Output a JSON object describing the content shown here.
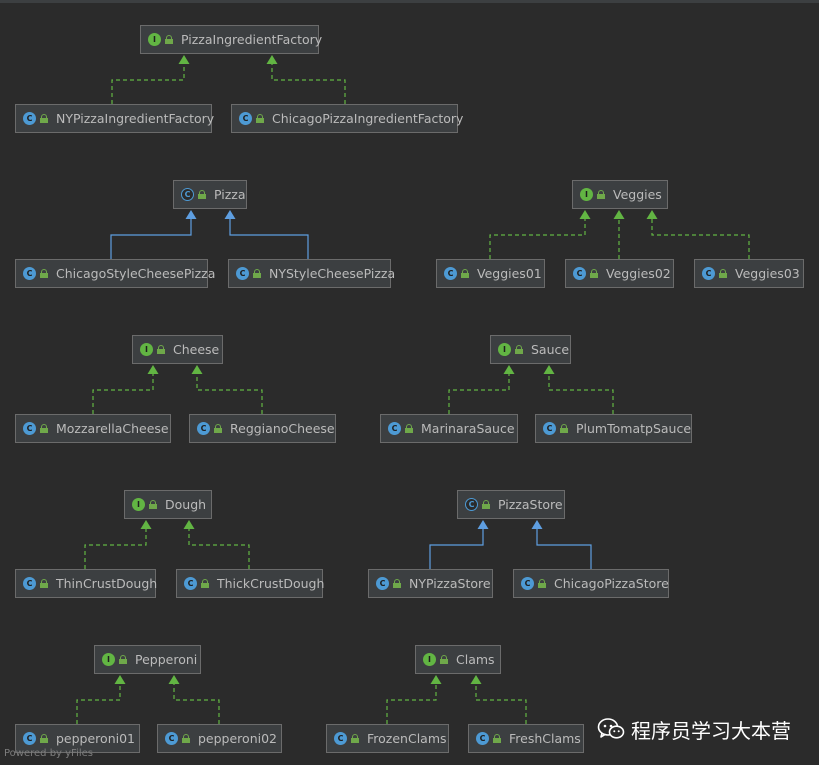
{
  "diagram": {
    "edge_colors": {
      "implements": "#62b543",
      "extends": "#5e9ee0"
    },
    "nodes": [
      {
        "id": "PizzaIngredientFactory",
        "label": "PizzaIngredientFactory",
        "kind": "interface"
      },
      {
        "id": "NYPizzaIngredientFactory",
        "label": "NYPizzaIngredientFactory",
        "kind": "class"
      },
      {
        "id": "ChicagoPizzaIngredientFactory",
        "label": "ChicagoPizzaIngredientFactory",
        "kind": "class"
      },
      {
        "id": "Pizza",
        "label": "Pizza",
        "kind": "abstract"
      },
      {
        "id": "ChicagoStyleCheesePizza",
        "label": "ChicagoStyleCheesePizza",
        "kind": "class"
      },
      {
        "id": "NYStyleCheesePizza",
        "label": "NYStyleCheesePizza",
        "kind": "class"
      },
      {
        "id": "Veggies",
        "label": "Veggies",
        "kind": "interface"
      },
      {
        "id": "Veggies01",
        "label": "Veggies01",
        "kind": "class"
      },
      {
        "id": "Veggies02",
        "label": "Veggies02",
        "kind": "class"
      },
      {
        "id": "Veggies03",
        "label": "Veggies03",
        "kind": "class"
      },
      {
        "id": "Cheese",
        "label": "Cheese",
        "kind": "interface"
      },
      {
        "id": "MozzarellaCheese",
        "label": "MozzarellaCheese",
        "kind": "class"
      },
      {
        "id": "ReggianoCheese",
        "label": "ReggianoCheese",
        "kind": "class"
      },
      {
        "id": "Sauce",
        "label": "Sauce",
        "kind": "interface"
      },
      {
        "id": "MarinaraSauce",
        "label": "MarinaraSauce",
        "kind": "class"
      },
      {
        "id": "PlumTomatpSauce",
        "label": "PlumTomatpSauce",
        "kind": "class"
      },
      {
        "id": "Dough",
        "label": "Dough",
        "kind": "interface"
      },
      {
        "id": "ThinCrustDough",
        "label": "ThinCrustDough",
        "kind": "class"
      },
      {
        "id": "ThickCrustDough",
        "label": "ThickCrustDough",
        "kind": "class"
      },
      {
        "id": "PizzaStore",
        "label": "PizzaStore",
        "kind": "abstract"
      },
      {
        "id": "NYPizzaStore",
        "label": "NYPizzaStore",
        "kind": "class"
      },
      {
        "id": "ChicagoPizzaStore",
        "label": "ChicagoPizzaStore",
        "kind": "class"
      },
      {
        "id": "Pepperoni",
        "label": "Pepperoni",
        "kind": "interface"
      },
      {
        "id": "pepperoni01",
        "label": "pepperoni01",
        "kind": "class"
      },
      {
        "id": "pepperoni02",
        "label": "pepperoni02",
        "kind": "class"
      },
      {
        "id": "Clams",
        "label": "Clams",
        "kind": "interface"
      },
      {
        "id": "FrozenClams",
        "label": "FrozenClams",
        "kind": "class"
      },
      {
        "id": "FreshClams",
        "label": "FreshClams",
        "kind": "class"
      }
    ],
    "edges": [
      {
        "from": "NYPizzaIngredientFactory",
        "to": "PizzaIngredientFactory",
        "type": "implements"
      },
      {
        "from": "ChicagoPizzaIngredientFactory",
        "to": "PizzaIngredientFactory",
        "type": "implements"
      },
      {
        "from": "ChicagoStyleCheesePizza",
        "to": "Pizza",
        "type": "extends"
      },
      {
        "from": "NYStyleCheesePizza",
        "to": "Pizza",
        "type": "extends"
      },
      {
        "from": "Veggies01",
        "to": "Veggies",
        "type": "implements"
      },
      {
        "from": "Veggies02",
        "to": "Veggies",
        "type": "implements"
      },
      {
        "from": "Veggies03",
        "to": "Veggies",
        "type": "implements"
      },
      {
        "from": "MozzarellaCheese",
        "to": "Cheese",
        "type": "implements"
      },
      {
        "from": "ReggianoCheese",
        "to": "Cheese",
        "type": "implements"
      },
      {
        "from": "MarinaraSauce",
        "to": "Sauce",
        "type": "implements"
      },
      {
        "from": "PlumTomatpSauce",
        "to": "Sauce",
        "type": "implements"
      },
      {
        "from": "ThinCrustDough",
        "to": "Dough",
        "type": "implements"
      },
      {
        "from": "ThickCrustDough",
        "to": "Dough",
        "type": "implements"
      },
      {
        "from": "NYPizzaStore",
        "to": "PizzaStore",
        "type": "extends"
      },
      {
        "from": "ChicagoPizzaStore",
        "to": "PizzaStore",
        "type": "extends"
      },
      {
        "from": "pepperoni01",
        "to": "Pepperoni",
        "type": "implements"
      },
      {
        "from": "pepperoni02",
        "to": "Pepperoni",
        "type": "implements"
      },
      {
        "from": "FrozenClams",
        "to": "Clams",
        "type": "implements"
      },
      {
        "from": "FreshClams",
        "to": "Clams",
        "type": "implements"
      }
    ],
    "badge_letters": {
      "interface": "I",
      "class": "C",
      "abstract": "C"
    }
  },
  "footer": {
    "brand": "Powered by yFiles"
  },
  "watermark": {
    "text": "程序员学习大本营",
    "icon": "wechat-icon"
  }
}
